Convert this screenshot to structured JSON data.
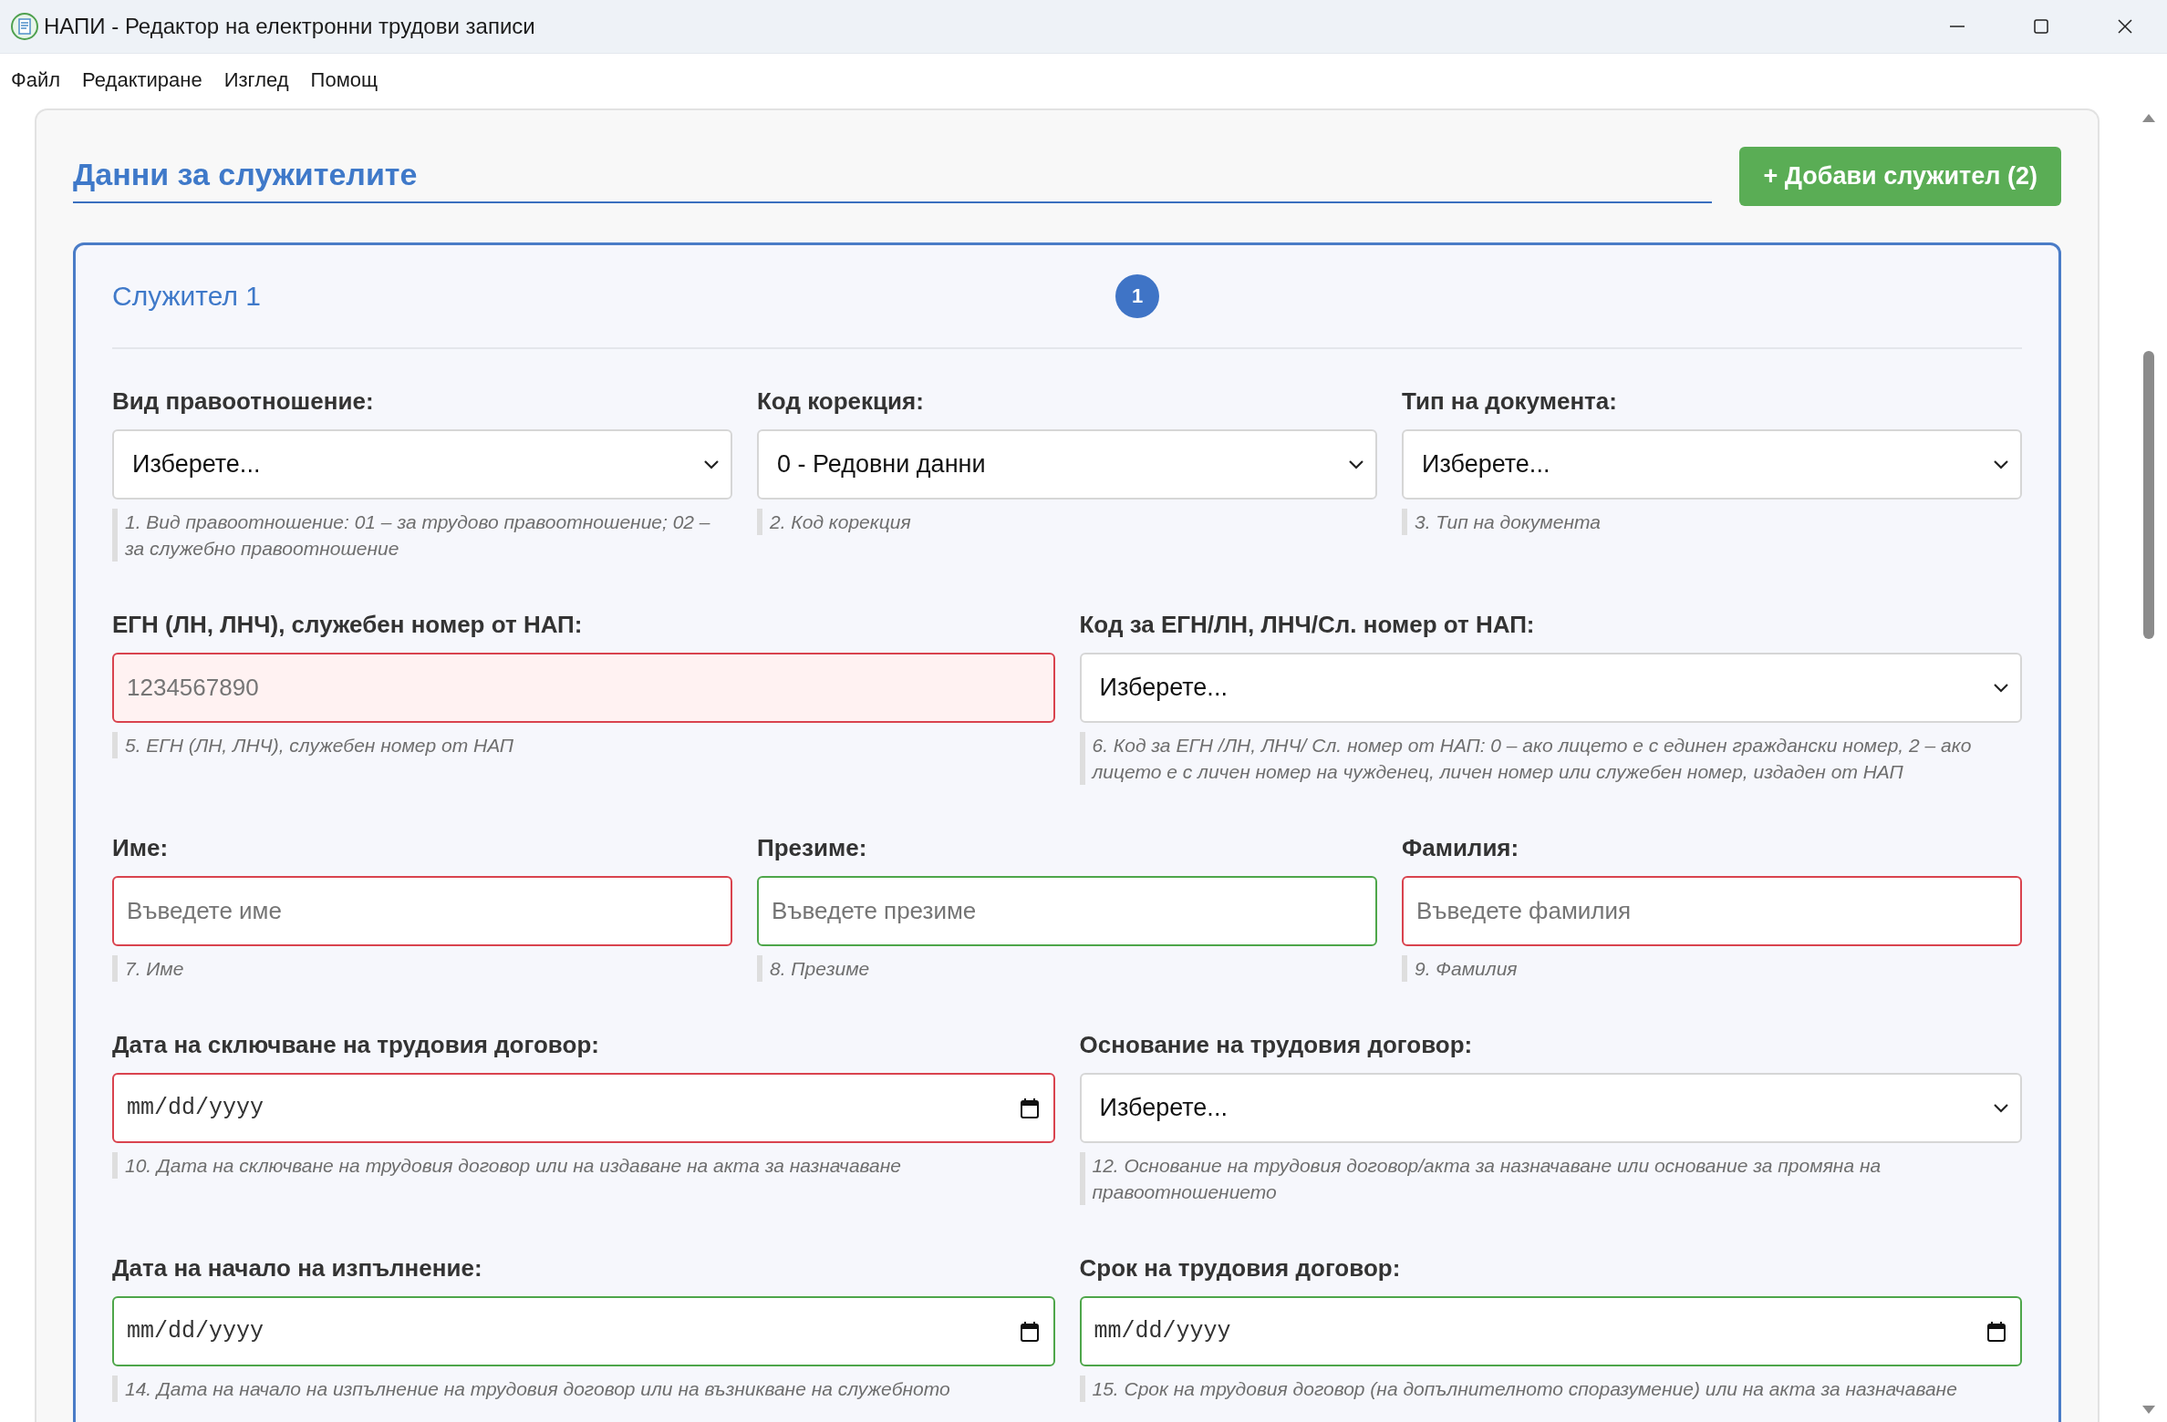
{
  "window": {
    "title": "НАПИ - Редактор на електронни трудови записи"
  },
  "menu": [
    {
      "label": "Файл"
    },
    {
      "label": "Редактиране"
    },
    {
      "label": "Изглед"
    },
    {
      "label": "Помощ"
    }
  ],
  "section": {
    "title": "Данни за служителите",
    "add_button": "+ Добави служител (2)"
  },
  "employee": {
    "title": "Служител 1",
    "badge": "1",
    "rows": [
      [
        {
          "label": "Вид правоотношение:",
          "kind": "select",
          "value": "Изберете...",
          "error": false,
          "valid": false,
          "tinted": false,
          "hint": "1. Вид правоотношение: 01 – за трудово правоотношение; 02 – за служебно правоотношение"
        },
        {
          "label": "Код корекция:",
          "kind": "select",
          "value": "0 - Редовни данни",
          "error": false,
          "valid": false,
          "tinted": false,
          "hint": "2. Код корекция"
        },
        {
          "label": "Тип на документа:",
          "kind": "select",
          "value": "Изберете...",
          "error": false,
          "valid": false,
          "tinted": false,
          "hint": "3. Тип на документа"
        }
      ],
      [
        {
          "label": "ЕГН (ЛН, ЛНЧ), служебен номер от НАП:",
          "kind": "text",
          "placeholder": "1234567890",
          "error": true,
          "valid": false,
          "tinted": true,
          "hint": "5. ЕГН (ЛН, ЛНЧ), служебен номер от НАП"
        },
        {
          "label": "Код за ЕГН/ЛН, ЛНЧ/Сл. номер от НАП:",
          "kind": "select",
          "value": "Изберете...",
          "error": false,
          "valid": false,
          "tinted": false,
          "hint": "6. Код за ЕГН /ЛН, ЛНЧ/ Сл. номер от НАП: 0 – ако лицето е с единен граждански номер, 2 – ако лицето е с личен номер на чужденец, личен номер или служебен номер, издаден от НАП"
        }
      ],
      [
        {
          "label": "Име:",
          "kind": "text",
          "placeholder": "Въведете име",
          "error": true,
          "valid": false,
          "tinted": false,
          "hint": "7. Име"
        },
        {
          "label": "Презиме:",
          "kind": "text",
          "placeholder": "Въведете презиме",
          "error": false,
          "valid": true,
          "tinted": false,
          "hint": "8. Презиме"
        },
        {
          "label": "Фамилия:",
          "kind": "text",
          "placeholder": "Въведете фамилия",
          "error": true,
          "valid": false,
          "tinted": false,
          "hint": "9. Фамилия"
        }
      ],
      [
        {
          "label": "Дата на сключване на трудовия договор:",
          "kind": "date",
          "placeholder": "mm/dd/yyyy",
          "error": true,
          "valid": false,
          "tinted": false,
          "hint": "10. Дата на сключване на трудовия договор или на издаване на акта за назначаване"
        },
        {
          "label": "Основание на трудовия договор:",
          "kind": "select",
          "value": "Изберете...",
          "error": false,
          "valid": false,
          "tinted": false,
          "hint": "12. Основание на трудовия договор/акта за назначаване или основание за промяна на правоотношението"
        }
      ],
      [
        {
          "label": "Дата на начало на изпълнение:",
          "kind": "date",
          "placeholder": "mm/dd/yyyy",
          "error": false,
          "valid": true,
          "tinted": false,
          "hint": "14. Дата на начало на изпълнение на трудовия договор или на възникване на служебното"
        },
        {
          "label": "Срок на трудовия договор:",
          "kind": "date",
          "placeholder": "mm/dd/yyyy",
          "error": false,
          "valid": true,
          "tinted": false,
          "hint": "15. Срок на трудовия договор (на допълнителното споразумение) или на акта за назначаване"
        }
      ]
    ]
  }
}
